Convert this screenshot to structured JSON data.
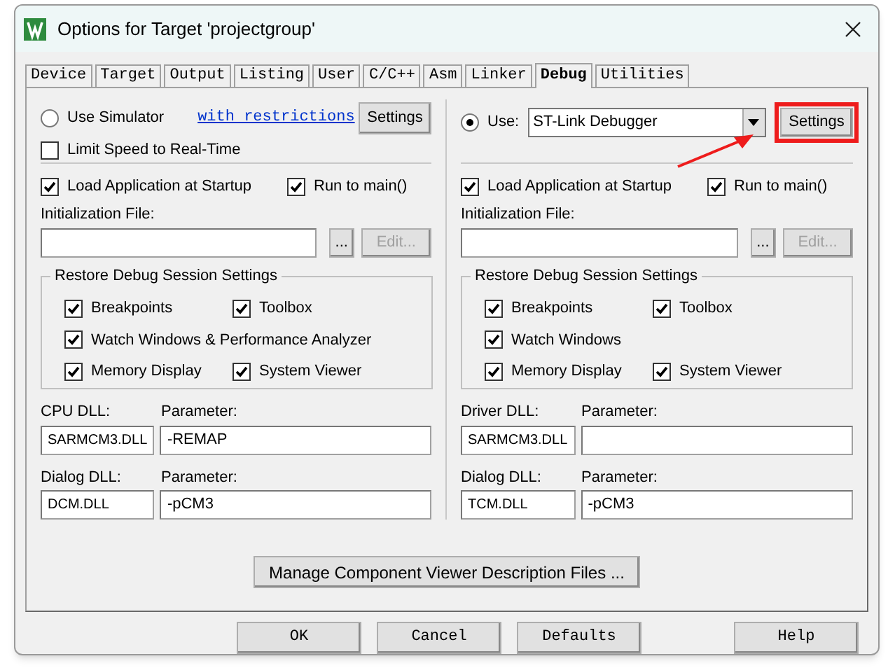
{
  "window": {
    "title": "Options for Target 'projectgroup'"
  },
  "tabs": [
    {
      "label": "Device",
      "selected": false
    },
    {
      "label": "Target",
      "selected": false
    },
    {
      "label": "Output",
      "selected": false
    },
    {
      "label": "Listing",
      "selected": false
    },
    {
      "label": "User",
      "selected": false
    },
    {
      "label": "C/C++",
      "selected": false
    },
    {
      "label": "Asm",
      "selected": false
    },
    {
      "label": "Linker",
      "selected": false
    },
    {
      "label": "Debug",
      "selected": true
    },
    {
      "label": "Utilities",
      "selected": false
    }
  ],
  "left": {
    "mode": {
      "label": "Use Simulator",
      "selected": false
    },
    "link": "with restrictions",
    "settings": {
      "label": "Settings",
      "highlighted": false
    },
    "limit_speed": {
      "label": "Limit Speed to Real-Time",
      "checked": false
    },
    "load_app": {
      "label": "Load Application at Startup",
      "checked": true
    },
    "run_to_main": {
      "label": "Run to main()",
      "checked": true
    },
    "init_label": "Initialization File:",
    "browse": "...",
    "edit": {
      "label": "Edit...",
      "disabled": true
    },
    "restore": {
      "title": "Restore Debug Session Settings",
      "rows": [
        [
          {
            "label": "Breakpoints",
            "checked": true
          },
          {
            "label": "Toolbox",
            "checked": true
          }
        ],
        [
          {
            "label": "Watch Windows & Performance Analyzer",
            "checked": true
          }
        ],
        [
          {
            "label": "Memory Display",
            "checked": true
          },
          {
            "label": "System Viewer",
            "checked": true
          }
        ]
      ]
    },
    "dlls": [
      {
        "label": "CPU DLL:",
        "value": "SARMCM3.DLL",
        "param_label": "Parameter:",
        "param": "-REMAP"
      },
      {
        "label": "Dialog DLL:",
        "value": "DCM.DLL",
        "param_label": "Parameter:",
        "param": "-pCM3"
      }
    ]
  },
  "right": {
    "mode": {
      "label": "Use:",
      "selected": true
    },
    "debugger": "ST-Link Debugger",
    "settings": {
      "label": "Settings",
      "highlighted": true
    },
    "load_app": {
      "label": "Load Application at Startup",
      "checked": true
    },
    "run_to_main": {
      "label": "Run to main()",
      "checked": true
    },
    "init_label": "Initialization File:",
    "browse": "...",
    "edit": {
      "label": "Edit...",
      "disabled": true
    },
    "restore": {
      "title": "Restore Debug Session Settings",
      "rows": [
        [
          {
            "label": "Breakpoints",
            "checked": true
          },
          {
            "label": "Toolbox",
            "checked": true
          }
        ],
        [
          {
            "label": "Watch Windows",
            "checked": true
          }
        ],
        [
          {
            "label": "Memory Display",
            "checked": true
          },
          {
            "label": "System Viewer",
            "checked": true
          }
        ]
      ]
    },
    "dlls": [
      {
        "label": "Driver DLL:",
        "value": "SARMCM3.DLL",
        "param_label": "Parameter:"
      },
      {
        "label": "Dialog DLL:",
        "value": "TCM.DLL",
        "param_label": "Parameter:",
        "param": "-pCM3"
      }
    ]
  },
  "manage_button": "Manage Component Viewer Description Files ...",
  "buttons": [
    "OK",
    "Cancel",
    "Defaults",
    "Help"
  ]
}
